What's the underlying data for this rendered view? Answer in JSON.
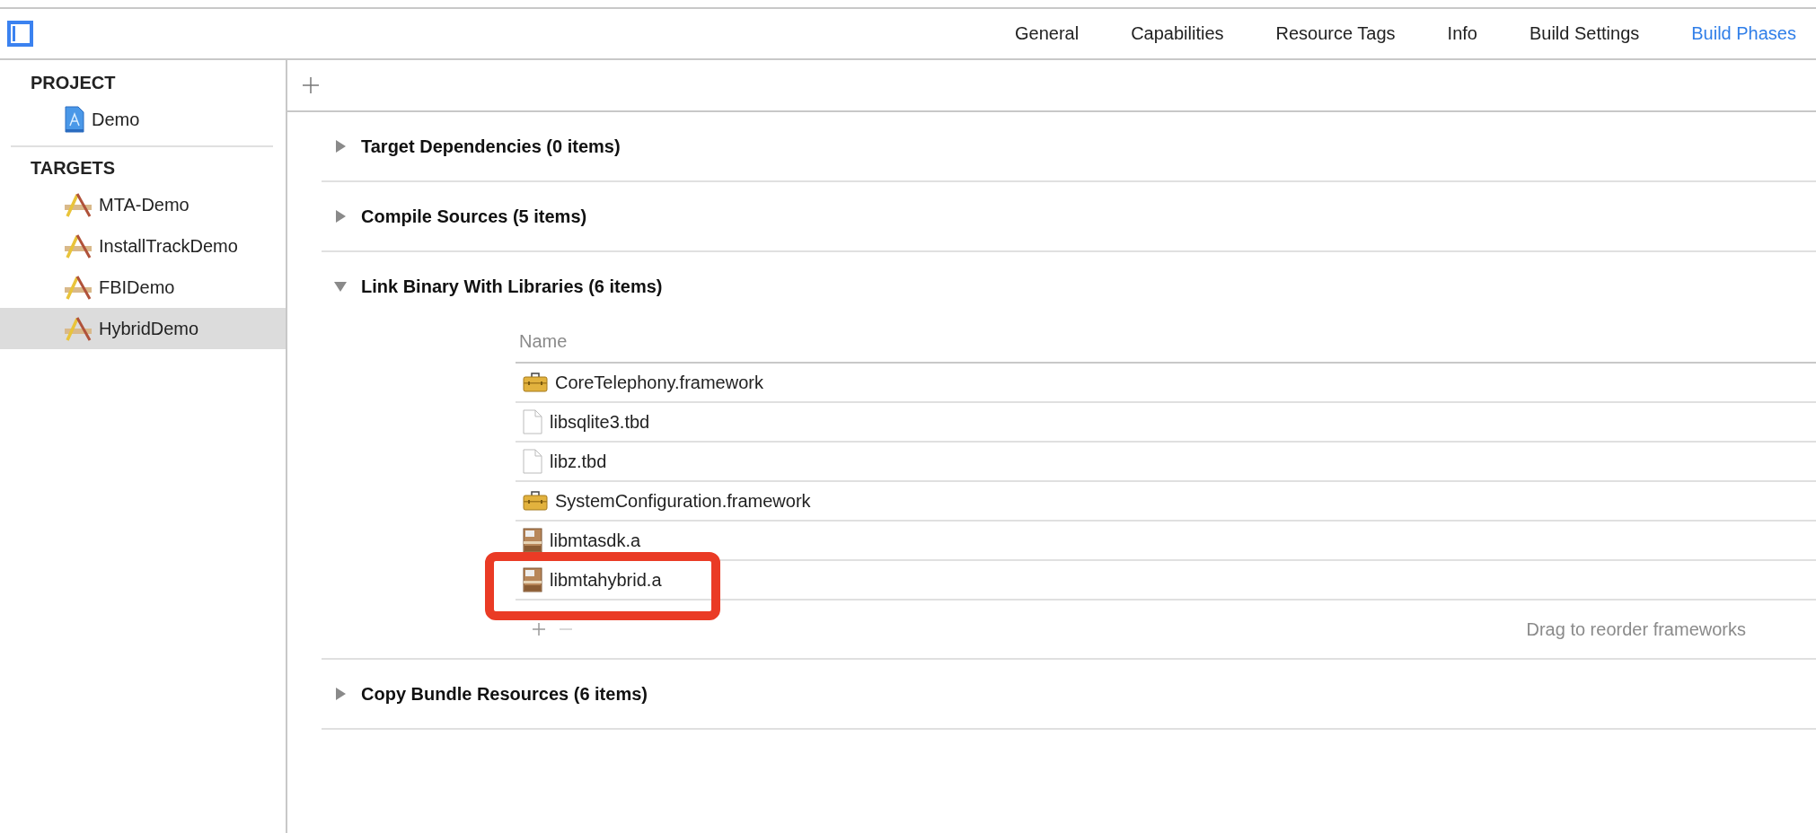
{
  "toolbar": {
    "tabs": [
      {
        "label": "General",
        "selected": false
      },
      {
        "label": "Capabilities",
        "selected": false
      },
      {
        "label": "Resource Tags",
        "selected": false
      },
      {
        "label": "Info",
        "selected": false
      },
      {
        "label": "Build Settings",
        "selected": false
      },
      {
        "label": "Build Phases",
        "selected": true
      }
    ]
  },
  "sidebar": {
    "sections": [
      {
        "heading": "PROJECT",
        "items": [
          {
            "label": "Demo",
            "kind": "project",
            "selected": false
          }
        ]
      },
      {
        "heading": "TARGETS",
        "items": [
          {
            "label": "MTA-Demo",
            "kind": "target",
            "selected": false
          },
          {
            "label": "InstallTrackDemo",
            "kind": "target",
            "selected": false
          },
          {
            "label": "FBIDemo",
            "kind": "target",
            "selected": false
          },
          {
            "label": "HybridDemo",
            "kind": "target",
            "selected": true
          }
        ]
      }
    ]
  },
  "phases": [
    {
      "title": "Target Dependencies (0 items)",
      "expanded": false
    },
    {
      "title": "Compile Sources (5 items)",
      "expanded": false
    },
    {
      "title": "Link Binary With Libraries (6 items)",
      "expanded": true,
      "table": {
        "columns": [
          "Name"
        ],
        "rows": [
          {
            "name": "CoreTelephony.framework",
            "kind": "framework",
            "highlighted": false
          },
          {
            "name": "libsqlite3.tbd",
            "kind": "file",
            "highlighted": false
          },
          {
            "name": "libz.tbd",
            "kind": "file",
            "highlighted": false
          },
          {
            "name": "SystemConfiguration.framework",
            "kind": "framework",
            "highlighted": false
          },
          {
            "name": "libmtasdk.a",
            "kind": "archive",
            "highlighted": false
          },
          {
            "name": "libmtahybrid.a",
            "kind": "archive",
            "highlighted": true
          }
        ],
        "hint": "Drag to reorder frameworks"
      }
    },
    {
      "title": "Copy Bundle Resources (6 items)",
      "expanded": false
    }
  ]
}
